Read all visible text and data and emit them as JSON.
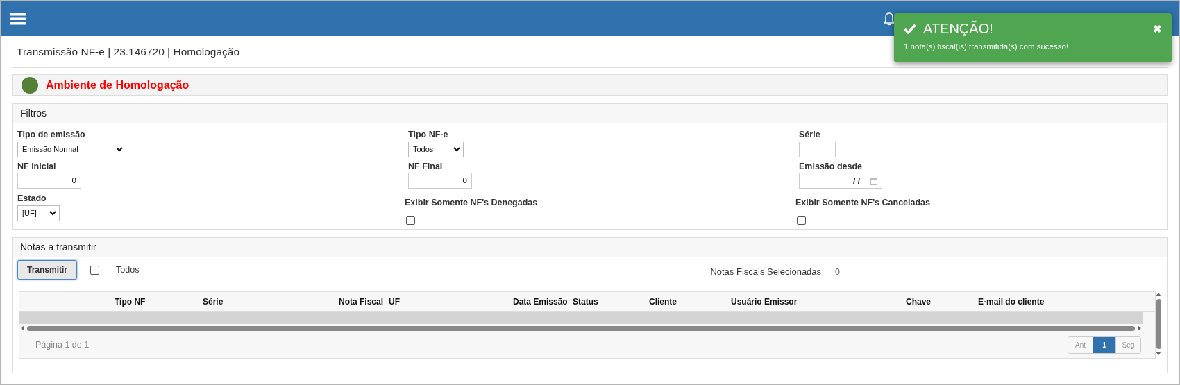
{
  "toast": {
    "title": "ATENÇÃO!",
    "message": "1 nota(s) fiscal(is) transmitida(s) com sucesso!",
    "close": "✖"
  },
  "breadcrumb": "Transmissão NF-e | 23.146720 | Homologação",
  "environment": {
    "label": "Ambiente de Homologação",
    "color": "#538135"
  },
  "filters": {
    "title": "Filtros",
    "fields": [
      {
        "kind": "select",
        "label": "Tipo de emissão",
        "value": "Emissão Normal"
      },
      {
        "kind": "select",
        "label": "Tipo NF-e",
        "value": "Todos"
      },
      {
        "kind": "text",
        "label": "Série"
      },
      {
        "kind": "number",
        "label": "NF Inicial",
        "value": "0"
      },
      {
        "kind": "number",
        "label": "NF Final",
        "value": "0"
      },
      {
        "kind": "date",
        "label": "Emissão desde",
        "value": "/ /"
      },
      {
        "kind": "select",
        "label": "Estado",
        "value": "[UF]"
      },
      {
        "kind": "checkbox",
        "label": "Exibir Somente NF's Denegadas",
        "checked": false
      },
      {
        "kind": "checkbox",
        "label": "Exibir Somente NF's Canceladas",
        "checked": false
      }
    ]
  },
  "notes": {
    "title": "Notas a transmitir",
    "button": "Transmitir",
    "select_all": {
      "label": "Todos",
      "checked": false
    },
    "selected_label": "Notas Fiscais Selecionadas",
    "selected_count": "0",
    "table": {
      "columns": [
        "Tipo NF",
        "Série",
        "Nota Fiscal",
        "UF",
        "Data Emissão",
        "Status",
        "Cliente",
        "Usuário Emissor",
        "Chave",
        "E-mail do cliente"
      ]
    },
    "pagination": {
      "info": "Página 1 de 1",
      "prev": "Ant",
      "pages": [
        {
          "label": "1",
          "selected": true
        }
      ],
      "next": "Seg"
    }
  }
}
